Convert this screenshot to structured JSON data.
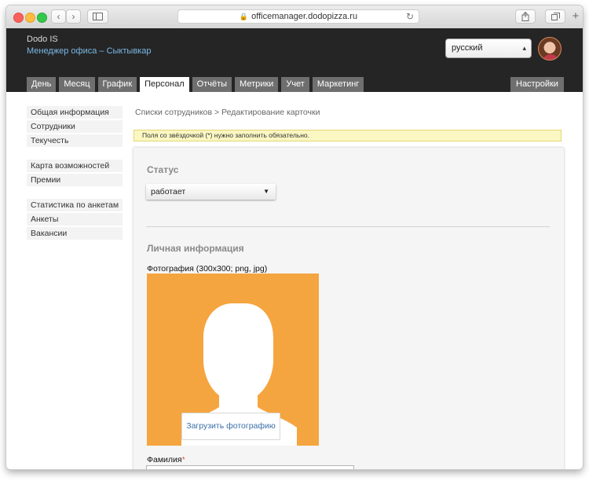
{
  "browser": {
    "url": "officemanager.dodopizza.ru"
  },
  "header": {
    "brand": "Dodo IS",
    "office": "Менеджер офиса – Сыктывкар",
    "language": "русский"
  },
  "nav": {
    "tabs": [
      {
        "label": "День"
      },
      {
        "label": "Месяц"
      },
      {
        "label": "График"
      },
      {
        "label": "Персонал",
        "active": true
      },
      {
        "label": "Отчёты"
      },
      {
        "label": "Метрики"
      },
      {
        "label": "Учет"
      },
      {
        "label": "Маркетинг"
      }
    ],
    "settings": "Настройки"
  },
  "sidebar": {
    "groups": [
      {
        "items": [
          {
            "label": "Общая информация"
          },
          {
            "label": "Сотрудники"
          },
          {
            "label": "Текучесть"
          }
        ]
      },
      {
        "items": [
          {
            "label": "Карта возможностей"
          },
          {
            "label": "Премии"
          }
        ]
      },
      {
        "items": [
          {
            "label": "Статистика по анкетам"
          },
          {
            "label": "Анкеты"
          },
          {
            "label": "Вакансии"
          }
        ]
      }
    ]
  },
  "main": {
    "breadcrumb": "Списки сотрудников > Редактирование карточки",
    "notice": "Поля со звёздочкой (*) нужно заполнить обязательно.",
    "status_heading": "Статус",
    "status_value": "работает",
    "personal_heading": "Личная информация",
    "photo_label": "Фотография (300x300; png, jpg)",
    "upload_button": "Загрузить фотографию",
    "lastname_label": "Фамилия",
    "required_mark": "*",
    "lastname_value": ""
  },
  "colors": {
    "header_bg": "#252525",
    "tab_bg": "#6f6f6f",
    "photo_bg": "#f5a53f",
    "link": "#7ab8e6",
    "notice_bg": "#fbf7c2"
  }
}
